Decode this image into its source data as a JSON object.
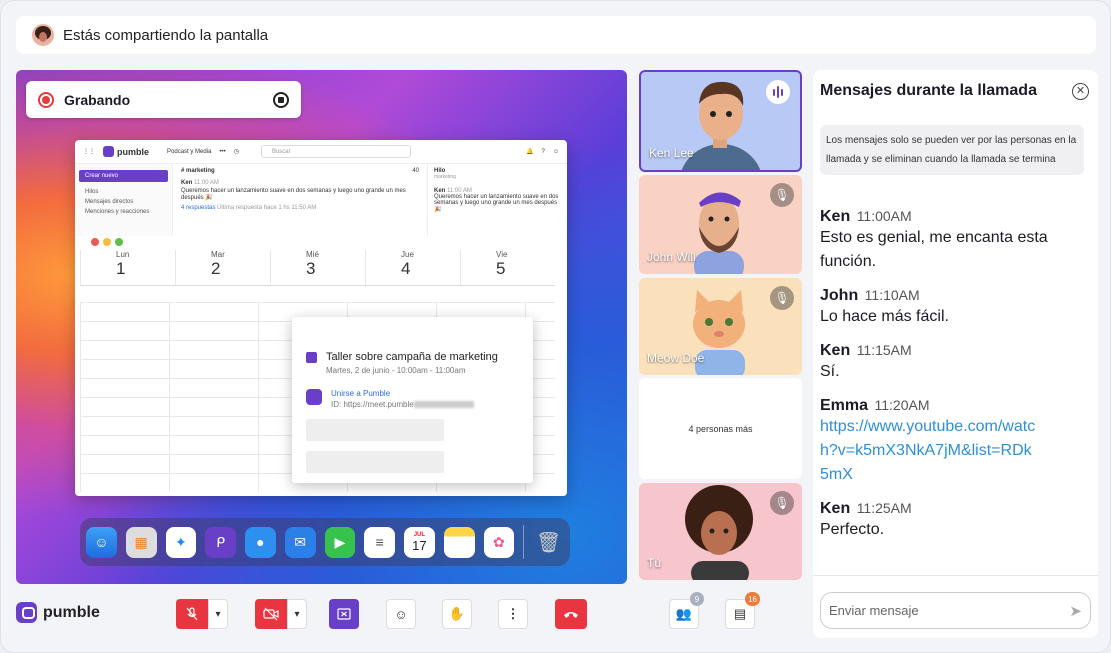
{
  "share_bar": {
    "text": "Estás compartiendo la pantalla"
  },
  "recording": {
    "label": "Grabando"
  },
  "shared_app": {
    "logo": "pumble",
    "workspace": "Podcast y Media",
    "search_placeholder": "Buscar",
    "new_button": "Crear nuevo",
    "sidebar_items": [
      "Hilos",
      "Mensajes directos",
      "Menciones y reacciones"
    ],
    "channel": "# marketing",
    "member_count": "40",
    "message_author": "Ken",
    "message_time": "11:00 AM",
    "message_text": "Queremos hacer un lanzamiento suave en dos semanas y luego uno grande un mes después 🎉",
    "replies_text": "4 respuestas",
    "last_reply_text": "Última respuesta hace 1 hs 11:50 AM",
    "thread_title": "Hilo",
    "thread_channel": "marketing",
    "thread_author": "Ken",
    "thread_time": "11:00 AM",
    "thread_text": "Queremos hacer un lanzamiento suave en dos semanas y luego uno grande un mes después 🎉"
  },
  "calendar": {
    "days": [
      {
        "name": "Lun",
        "num": "1"
      },
      {
        "name": "Mar",
        "num": "2"
      },
      {
        "name": "Mié",
        "num": "3"
      },
      {
        "name": "Jue",
        "num": "4"
      },
      {
        "name": "Vie",
        "num": "5"
      }
    ],
    "event": {
      "title": "Taller sobre campaña de marketing",
      "time": "Martes, 2 de junio - 10:00am - 11:00am",
      "join_label": "Unirse a Pumble",
      "join_id": "ID: https://meet.pumble"
    }
  },
  "dock": {
    "apps": [
      "finder-icon",
      "launchpad-icon",
      "safari-icon",
      "pumble-icon",
      "messages-icon",
      "mail-icon",
      "facetime-icon",
      "reminders-icon",
      "calendar-icon",
      "notes-icon",
      "photos-icon",
      "trash-icon"
    ],
    "calendar_month": "JUL",
    "calendar_day": "17"
  },
  "participants": [
    {
      "name": "Ken Lee",
      "color": "#b9c9f5",
      "state": "speaking"
    },
    {
      "name": "John Will",
      "color": "#f9d2c4",
      "state": "muted"
    },
    {
      "name": "Meow Doe",
      "color": "#fbe1bb",
      "state": "muted"
    },
    {
      "name": "",
      "more_label": "4 personas más",
      "state": "more"
    },
    {
      "name": "Tú",
      "color": "#f7c5cc",
      "state": "muted"
    }
  ],
  "chat": {
    "title": "Mensajes durante la llamada",
    "note": "Los mensajes solo se pueden ver por las personas en la llamada y se eliminan cuando la llamada se termina",
    "messages": [
      {
        "author": "Ken",
        "time": "11:00AM",
        "text": "Esto es genial, me encanta esta función."
      },
      {
        "author": "John",
        "time": "11:10AM",
        "text": "Lo hace más fácil."
      },
      {
        "author": "Ken",
        "time": "11:15AM",
        "text": "Sí."
      },
      {
        "author": "Emma",
        "time": "11:20AM",
        "text": "https://www.youtube.com/watch?v=k5mX3NkA7jM&list=RDk5mX",
        "is_link": true
      },
      {
        "author": "Ken",
        "time": "11:25AM",
        "text": "Perfecto."
      }
    ],
    "input_placeholder": "Enviar mensaje"
  },
  "toolbar": {
    "logo": "pumble",
    "participants_count": "9",
    "chat_count": "16"
  },
  "colors": {
    "brand": "#6a3fc7",
    "danger": "#e8353f",
    "link": "#2d8fd6"
  }
}
